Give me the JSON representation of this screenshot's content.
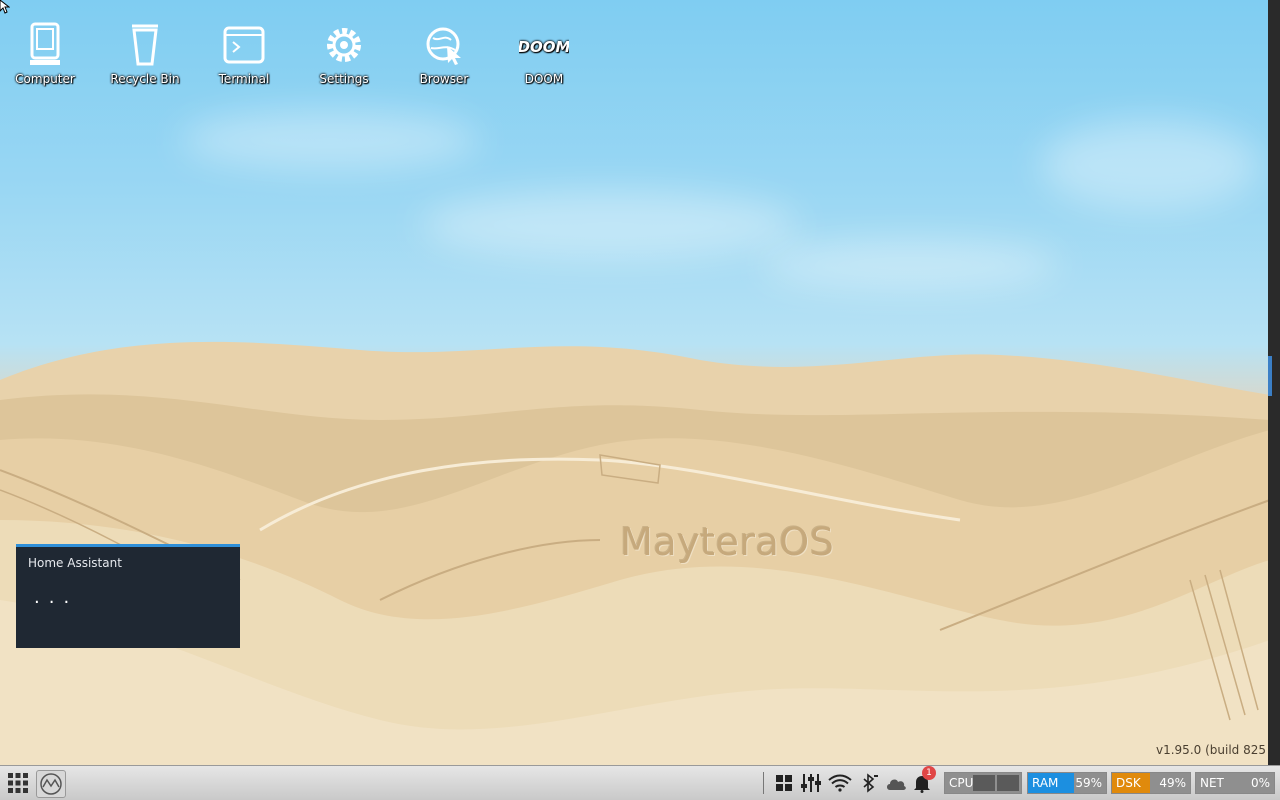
{
  "desktop_icons": [
    {
      "label": "Computer",
      "icon": "computer-icon"
    },
    {
      "label": "Recycle Bin",
      "icon": "recycle-bin-icon"
    },
    {
      "label": "Terminal",
      "icon": "terminal-icon"
    },
    {
      "label": "Settings",
      "icon": "gear-icon"
    },
    {
      "label": "Browser",
      "icon": "browser-icon"
    },
    {
      "label": "DOOM",
      "icon": "doom-icon"
    }
  ],
  "wallpaper": {
    "watermark": "MayteraOS"
  },
  "version": "v1.95.0 (build 825",
  "widget": {
    "title": "Home Assistant",
    "loading": "..."
  },
  "taskbar": {
    "notification_count": "1",
    "meters": {
      "cpu": {
        "label": "CPU",
        "value": "",
        "fraction": 0.0,
        "color": "#8f8f8f"
      },
      "ram": {
        "label": "RAM",
        "value": "59%",
        "fraction": 0.59,
        "color": "#1c8fe0"
      },
      "dsk": {
        "label": "DSK",
        "value": "49%",
        "fraction": 0.49,
        "color": "#e08a0c"
      },
      "net": {
        "label": "NET",
        "value": "0%",
        "fraction": 0.0,
        "color": "#8f8f8f"
      }
    }
  },
  "colors": {
    "widget_bg": "#1f2833",
    "widget_accent": "#2f8fd8",
    "sky": "#7fcdf2",
    "sand": "#e5cfa8"
  }
}
